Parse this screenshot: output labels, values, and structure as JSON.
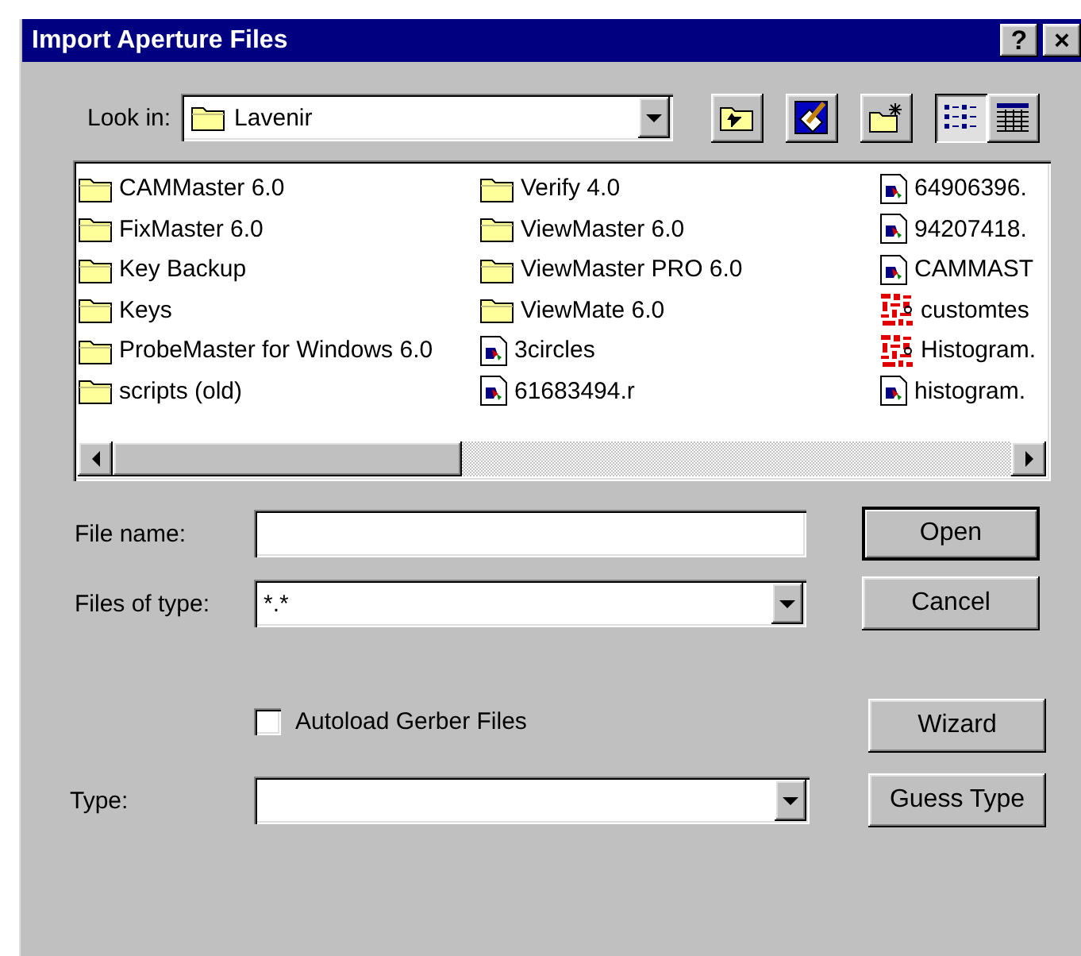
{
  "window": {
    "title": "Import Aperture Files",
    "help": "?",
    "close": "×"
  },
  "look_in": {
    "label": "Look in:",
    "value": "Lavenir"
  },
  "toolbar": [
    {
      "kind": "up-folder",
      "selected": false
    },
    {
      "kind": "desktop",
      "selected": false
    },
    {
      "kind": "new-folder",
      "selected": false
    },
    {
      "kind": "list-view",
      "selected": true
    },
    {
      "kind": "details-view",
      "selected": false
    }
  ],
  "files": [
    {
      "name": "CAMMaster 6.0",
      "kind": "folder"
    },
    {
      "name": "FixMaster 6.0",
      "kind": "folder"
    },
    {
      "name": "Key Backup",
      "kind": "folder"
    },
    {
      "name": "Keys",
      "kind": "folder"
    },
    {
      "name": "ProbeMaster for Windows 6.0",
      "kind": "folder"
    },
    {
      "name": "scripts (old)",
      "kind": "folder"
    },
    {
      "name": "Verify 4.0",
      "kind": "folder"
    },
    {
      "name": "ViewMaster 6.0",
      "kind": "folder"
    },
    {
      "name": "ViewMaster PRO 6.0",
      "kind": "folder"
    },
    {
      "name": "ViewMate 6.0",
      "kind": "folder"
    },
    {
      "name": "3circles",
      "kind": "document"
    },
    {
      "name": "61683494.r",
      "kind": "document"
    },
    {
      "name": "64906396.",
      "kind": "document"
    },
    {
      "name": "94207418.",
      "kind": "document"
    },
    {
      "name": "CAMMAST",
      "kind": "document"
    },
    {
      "name": "customtes",
      "kind": "image"
    },
    {
      "name": "Histogram.",
      "kind": "image"
    },
    {
      "name": "histogram.",
      "kind": "document"
    }
  ],
  "file_name": {
    "label": "File name:"
  },
  "files_of_type": {
    "label": "Files of type:",
    "value": "*.*"
  },
  "autoload": {
    "label": "Autoload Gerber Files",
    "checked": false
  },
  "type": {
    "label": "Type:"
  },
  "buttons": [
    {
      "label": "Open",
      "default": true
    },
    {
      "label": "Cancel",
      "default": false
    },
    {
      "label": "Wizard",
      "default": false
    },
    {
      "label": "Guess Type",
      "default": false
    }
  ]
}
